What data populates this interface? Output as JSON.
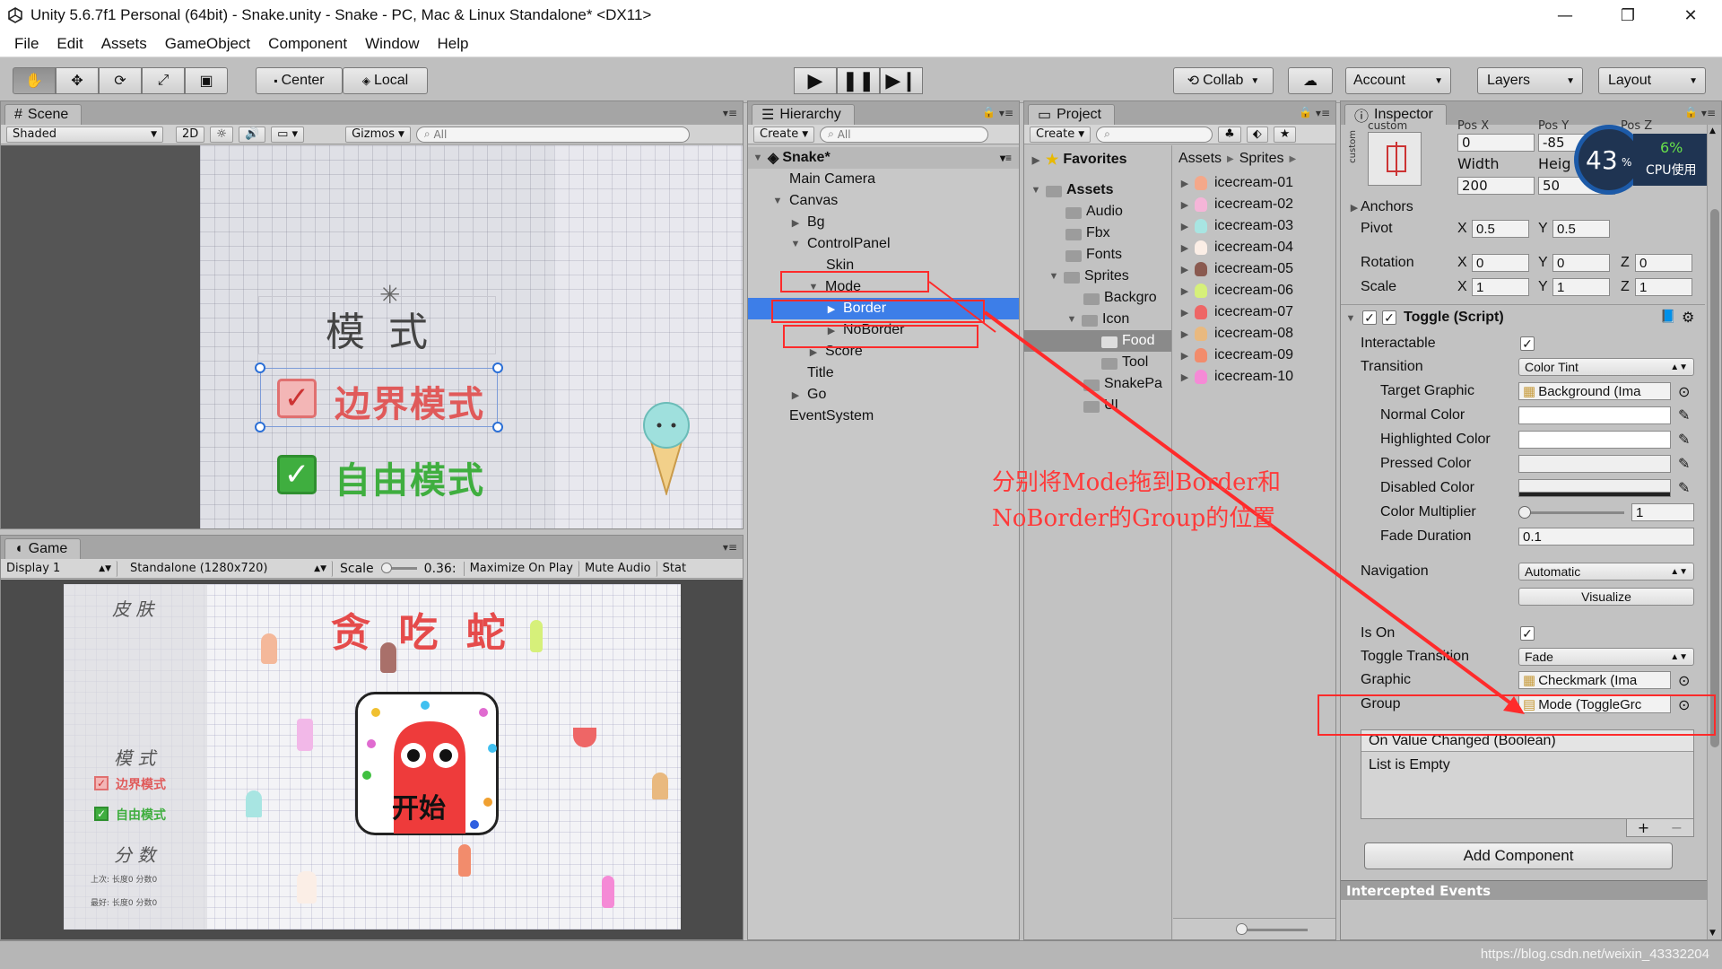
{
  "window": {
    "title": "Unity 5.6.7f1 Personal (64bit) - Snake.unity - Snake - PC, Mac & Linux Standalone* <DX11>",
    "controls": [
      "—",
      "❐",
      "✕"
    ]
  },
  "menu": [
    "File",
    "Edit",
    "Assets",
    "GameObject",
    "Component",
    "Window",
    "Help"
  ],
  "toolbar": {
    "pivot": "Center",
    "space": "Local",
    "collab": "Collab",
    "account": "Account",
    "layers": "Layers",
    "layout": "Layout"
  },
  "scene": {
    "tab": "Scene",
    "shading": "Shaded",
    "mode2d": "2D",
    "gizmos": "Gizmos",
    "search": "All",
    "mode_title": "模 式",
    "option_border": "边界模式",
    "option_free": "自由模式"
  },
  "game": {
    "tab": "Game",
    "display": "Display 1",
    "resolution": "Standalone (1280x720)",
    "scale_label": "Scale",
    "scale_value": "0.36:",
    "maximize": "Maximize On Play",
    "mute": "Mute Audio",
    "stats": "Stat",
    "skin": "皮 肤",
    "game_title": "贪 吃 蛇",
    "mode": "模 式",
    "opt_border": "边界模式",
    "opt_free": "自由模式",
    "score": "分 数",
    "score_last": "上次: 长度0 分数0",
    "score_best": "最好: 长度0 分数0",
    "start": "开始"
  },
  "hierarchy": {
    "tab": "Hierarchy",
    "create": "Create",
    "search": "All",
    "scene": "Snake*",
    "items": [
      "Main Camera",
      "Canvas",
      "Bg",
      "ControlPanel",
      "Skin",
      "Mode",
      "Border",
      "NoBorder",
      "Score",
      "Title",
      "Go",
      "EventSystem"
    ]
  },
  "project": {
    "tab": "Project",
    "create": "Create",
    "favorites": "Favorites",
    "assets": "Assets",
    "folders": [
      "Audio",
      "Fbx",
      "Fonts",
      "Sprites",
      "Backgro",
      "Icon",
      "Food",
      "Tool",
      "SnakePa",
      "UI"
    ],
    "breadcrumb": [
      "Assets",
      "Sprites"
    ],
    "files": [
      "icecream-01",
      "icecream-02",
      "icecream-03",
      "icecream-04",
      "icecream-05",
      "icecream-06",
      "icecream-07",
      "icecream-08",
      "icecream-09",
      "icecream-10"
    ]
  },
  "inspector": {
    "tab": "Inspector",
    "custom": "custom",
    "pos_x_label": "Pos X",
    "pos_y_label": "Pos Y",
    "pos_z_label": "Pos Z",
    "pos_x": "0",
    "pos_y": "-85",
    "width_label": "Width",
    "height_label": "Heig",
    "width": "200",
    "height": "50",
    "anchors": "Anchors",
    "pivot_label": "Pivot",
    "pivot_x": "0.5",
    "pivot_y": "0.5",
    "rotation_label": "Rotation",
    "rot_x": "0",
    "rot_y": "0",
    "rot_z": "0",
    "scale_label": "Scale",
    "scale_x": "1",
    "scale_y": "1",
    "scale_z": "1",
    "component": "Toggle (Script)",
    "interactable": "Interactable",
    "transition": "Transition",
    "transition_value": "Color Tint",
    "target_graphic": "Target Graphic",
    "target_graphic_value": "Background (Ima",
    "normal_color": "Normal Color",
    "highlighted_color": "Highlighted Color",
    "pressed_color": "Pressed Color",
    "disabled_color": "Disabled Color",
    "color_multiplier": "Color Multiplier",
    "color_multiplier_value": "1",
    "fade_duration": "Fade Duration",
    "fade_duration_value": "0.1",
    "navigation": "Navigation",
    "navigation_value": "Automatic",
    "visualize": "Visualize",
    "is_on": "Is On",
    "toggle_transition": "Toggle Transition",
    "toggle_transition_value": "Fade",
    "graphic": "Graphic",
    "graphic_value": "Checkmark (Ima",
    "group": "Group",
    "group_value": "Mode (ToggleGrc",
    "event_title": "On Value Changed (Boolean)",
    "event_body": "List is Empty",
    "add_component": "Add Component",
    "intercepted": "Intercepted Events"
  },
  "cpu_widget": {
    "percent": "43",
    "unit": "%",
    "cpu_value": "6%",
    "cpu_label": "CPU使用"
  },
  "annotation": {
    "line1": "分别将Mode拖到Border和",
    "line2": "NoBorder的Group的位置"
  },
  "watermark": "https://blog.csdn.net/weixin_43332204",
  "colors": {
    "selection": "#3d7ee8",
    "annotation_red": "#ff2b2b",
    "toggle_check": "#3fae3f",
    "toggle_border": "#e07070"
  }
}
